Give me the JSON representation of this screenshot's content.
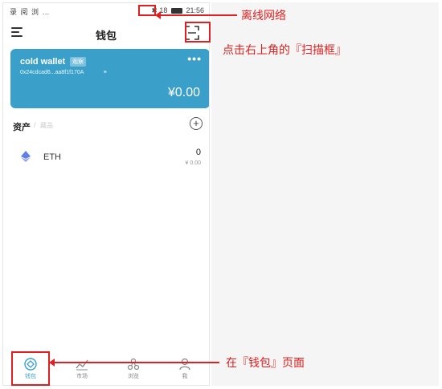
{
  "status_bar": {
    "left_icons": "录 阅 浏 …",
    "signal": "18",
    "time": "21:56"
  },
  "header": {
    "title": "钱包"
  },
  "wallet": {
    "name": "cold wallet",
    "badge": "观察",
    "address": "0x24cdcad6...aa8f1f170A",
    "copy_icon": "⚭",
    "more": "•••",
    "balance": "¥0.00",
    "card_color": "#3aa0c9"
  },
  "assets": {
    "title": "资产",
    "separator": "/",
    "subtitle": "藏品",
    "add_icon": "+",
    "items": [
      {
        "icon": "eth-icon",
        "symbol": "ETH",
        "amount": "0",
        "fiat": "¥ 0.00"
      }
    ]
  },
  "tabs": [
    {
      "label": "钱包",
      "icon": "wallet-tab-icon",
      "active": true
    },
    {
      "label": "市场",
      "icon": "market-tab-icon",
      "active": false
    },
    {
      "label": "浏览",
      "icon": "browse-tab-icon",
      "active": false
    },
    {
      "label": "我",
      "icon": "profile-tab-icon",
      "active": false
    }
  ],
  "annotations": {
    "offline": "离线网络",
    "scan": "点击右上角的『扫描框』",
    "wallet_page": "在『钱包』页面",
    "color": "#e02020"
  }
}
